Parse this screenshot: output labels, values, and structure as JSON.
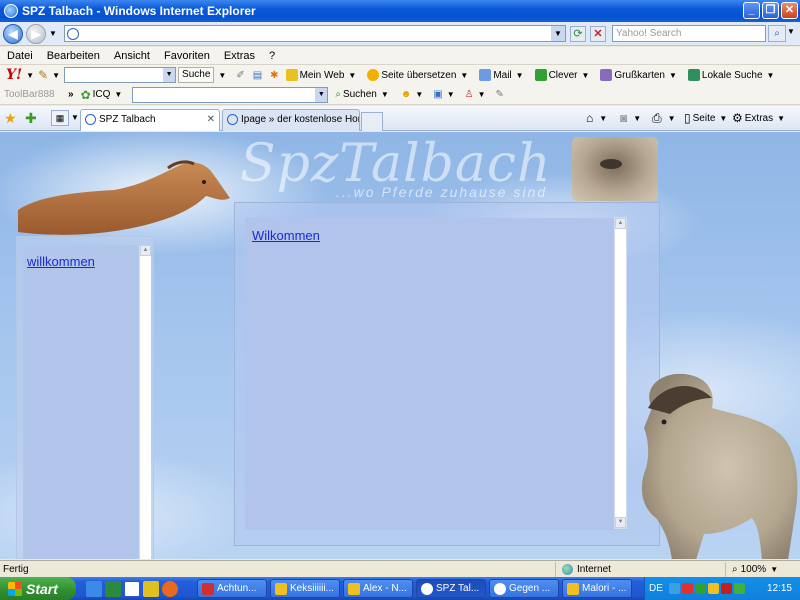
{
  "window": {
    "title": "SPZ Talbach - Windows Internet Explorer"
  },
  "address": {
    "url": "",
    "search_placeholder": "Yahoo! Search"
  },
  "menu": [
    "Datei",
    "Bearbeiten",
    "Ansicht",
    "Favoriten",
    "Extras",
    "?"
  ],
  "yahoo_toolbar": {
    "search_button": "Suche",
    "items": [
      "Mein Web",
      "Seite übersetzen",
      "Mail",
      "Clever",
      "Grußkarten",
      "Lokale Suche"
    ]
  },
  "toolbar888": {
    "label": "ToolBar888",
    "icq": "ICQ",
    "search": "Suchen"
  },
  "tabs": [
    {
      "label": "SPZ Talbach",
      "active": true
    },
    {
      "label": "Ipage » der kostenlose Hom...",
      "active": false
    }
  ],
  "commands": {
    "page": "Seite",
    "extras": "Extras"
  },
  "page": {
    "logo_title": "SpzTalbach",
    "logo_subtitle": "...wo Pferde zuhause sind",
    "sidebar_link": "willkommen",
    "main_link": "Wilkommen"
  },
  "status": {
    "text": "Fertig",
    "zone": "Internet",
    "zoom": "100%"
  },
  "taskbar": {
    "start": "Start",
    "tasks": [
      {
        "label": "Achtun...",
        "color": "#d03030",
        "active": false
      },
      {
        "label": "Keksiiiiii...",
        "color": "#f0c020",
        "active": false
      },
      {
        "label": "Alex - N...",
        "color": "#f0c020",
        "active": false
      },
      {
        "label": "SPZ Tal...",
        "color": "#ffffff",
        "active": true
      },
      {
        "label": "Gegen ...",
        "color": "#ffffff",
        "active": false
      },
      {
        "label": "Malori - ...",
        "color": "#f0c020",
        "active": false
      }
    ],
    "lang": "DE",
    "clock": "12:15"
  }
}
